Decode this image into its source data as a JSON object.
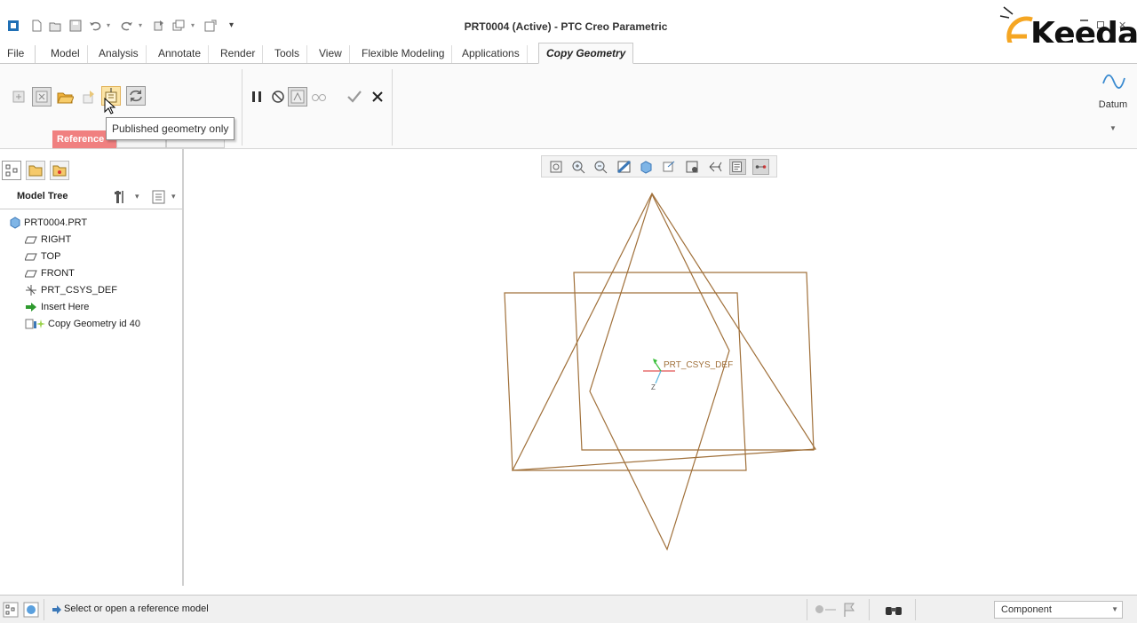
{
  "app": {
    "title": "PRT0004 (Active) - PTC Creo Parametric"
  },
  "logo": {
    "text": "Keeda",
    "brand_color": "#f5a623"
  },
  "tabs": [
    {
      "label": "File ▾"
    },
    {
      "label": "Model"
    },
    {
      "label": "Analysis"
    },
    {
      "label": "Annotate"
    },
    {
      "label": "Render"
    },
    {
      "label": "Tools"
    },
    {
      "label": "View"
    },
    {
      "label": "Flexible Modeling"
    },
    {
      "label": "Applications"
    },
    {
      "label": "Copy Geometry"
    }
  ],
  "ribbon": {
    "tooltip": "Published geometry only",
    "subtabs": [
      "Reference",
      "",
      ""
    ],
    "datum_label": "Datum"
  },
  "panel": {
    "title": "Model Tree",
    "tree": [
      {
        "label": "PRT0004.PRT",
        "icon": "part-icon"
      },
      {
        "label": "RIGHT",
        "icon": "datum-plane-icon"
      },
      {
        "label": "TOP",
        "icon": "datum-plane-icon"
      },
      {
        "label": "FRONT",
        "icon": "datum-plane-icon"
      },
      {
        "label": "PRT_CSYS_DEF",
        "icon": "csys-icon"
      },
      {
        "label": "Insert Here",
        "icon": "insert-arrow-icon"
      },
      {
        "label": "Copy Geometry id 40",
        "icon": "copy-geometry-icon"
      }
    ]
  },
  "graphics": {
    "csys_label": "PRT_CSYS_DEF",
    "axis_label": "Z",
    "plane_color": "#a0703a"
  },
  "status": {
    "message": "Select or open a reference model",
    "filter_value": "Component"
  }
}
